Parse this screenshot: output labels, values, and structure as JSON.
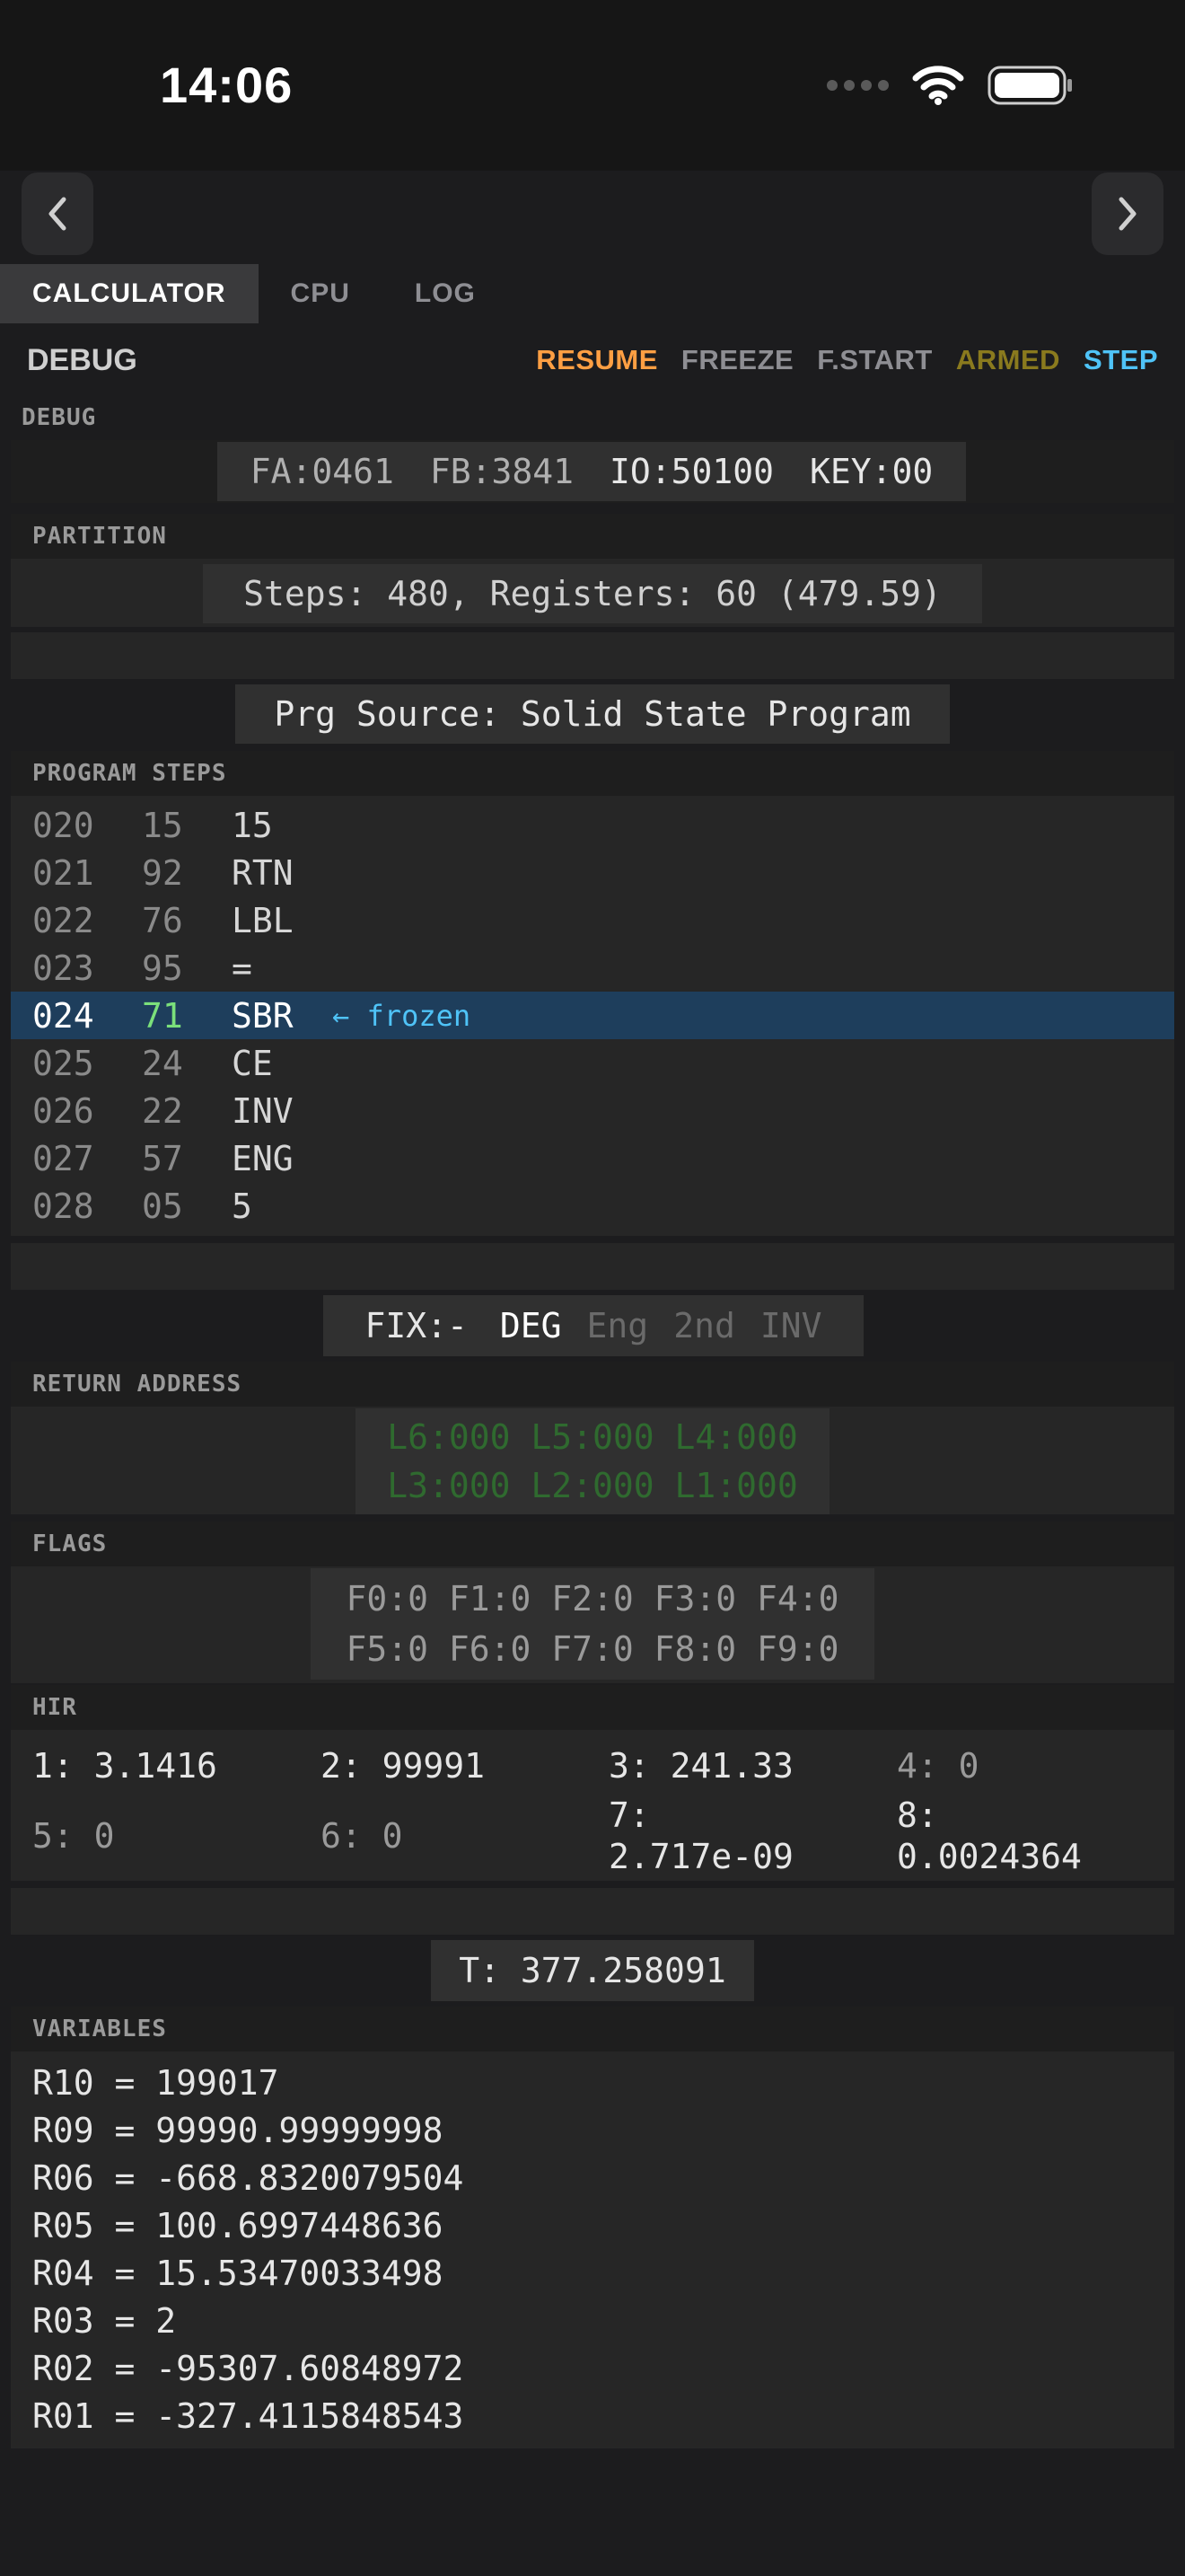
{
  "status_bar": {
    "time": "14:06"
  },
  "icons": {
    "back": "chevron-left-icon",
    "forward": "chevron-right-icon",
    "wifi": "wifi-icon",
    "battery": "battery-icon",
    "signal": "signal-dots-icon"
  },
  "tabs": [
    {
      "label": "CALCULATOR",
      "active": true
    },
    {
      "label": "CPU",
      "active": false
    },
    {
      "label": "LOG",
      "active": false
    }
  ],
  "debug": {
    "title": "DEBUG",
    "actions": [
      {
        "label": "RESUME",
        "color": "#ff9f43"
      },
      {
        "label": "FREEZE",
        "color": "#8e8e93"
      },
      {
        "label": "F.START",
        "color": "#8e8e93"
      },
      {
        "label": "ARMED",
        "color": "#8a7a1e"
      },
      {
        "label": "STEP",
        "color": "#4fc3f7"
      }
    ],
    "section_label": "DEBUG",
    "registers_line": [
      "FA:0461",
      "FB:3841",
      "IO:50100",
      "KEY:00"
    ]
  },
  "partition": {
    "label": "PARTITION",
    "value": "Steps: 480, Registers: 60 (479.59)"
  },
  "prg_source": "Prg Source: Solid State Program",
  "program_steps": {
    "label": "PROGRAM STEPS",
    "rows": [
      {
        "addr": "020",
        "code": "15",
        "mnemonic": "15"
      },
      {
        "addr": "021",
        "code": "92",
        "mnemonic": "RTN"
      },
      {
        "addr": "022",
        "code": "76",
        "mnemonic": "LBL"
      },
      {
        "addr": "023",
        "code": "95",
        "mnemonic": "="
      },
      {
        "addr": "024",
        "code": "71",
        "mnemonic": "SBR",
        "note": "← frozen",
        "current": true
      },
      {
        "addr": "025",
        "code": "24",
        "mnemonic": "CE"
      },
      {
        "addr": "026",
        "code": "22",
        "mnemonic": "INV"
      },
      {
        "addr": "027",
        "code": "57",
        "mnemonic": "ENG"
      },
      {
        "addr": "028",
        "code": "05",
        "mnemonic": "5"
      }
    ]
  },
  "mode": {
    "fix": "FIX:-",
    "deg": "DEG",
    "eng": "Eng",
    "second": "2nd",
    "inv": "INV"
  },
  "return_address": {
    "label": "RETURN ADDRESS",
    "line1": "L6:000 L5:000 L4:000",
    "line2": "L3:000 L2:000 L1:000"
  },
  "flags": {
    "label": "FLAGS",
    "line1": "F0:0 F1:0 F2:0 F3:0 F4:0",
    "line2": "F5:0 F6:0 F7:0 F8:0 F9:0"
  },
  "hir": {
    "label": "HIR",
    "row1": [
      "1: 3.1416",
      "2: 99991",
      "3: 241.33",
      "4: 0"
    ],
    "row2": [
      "5: 0",
      "6: 0",
      "7:\n2.717e-09",
      "8:\n0.0024364"
    ]
  },
  "t_register": "T: 377.258091",
  "variables": {
    "label": "VARIABLES",
    "rows": [
      "R10 = 199017",
      "R09 = 99990.99999998",
      "R06 = -668.8320079504",
      "R05 = 100.6997448636",
      "R04 = 15.53470033498",
      "R03 = 2",
      "R02 = -95307.60848972",
      "R01 = -327.4115848543"
    ]
  }
}
